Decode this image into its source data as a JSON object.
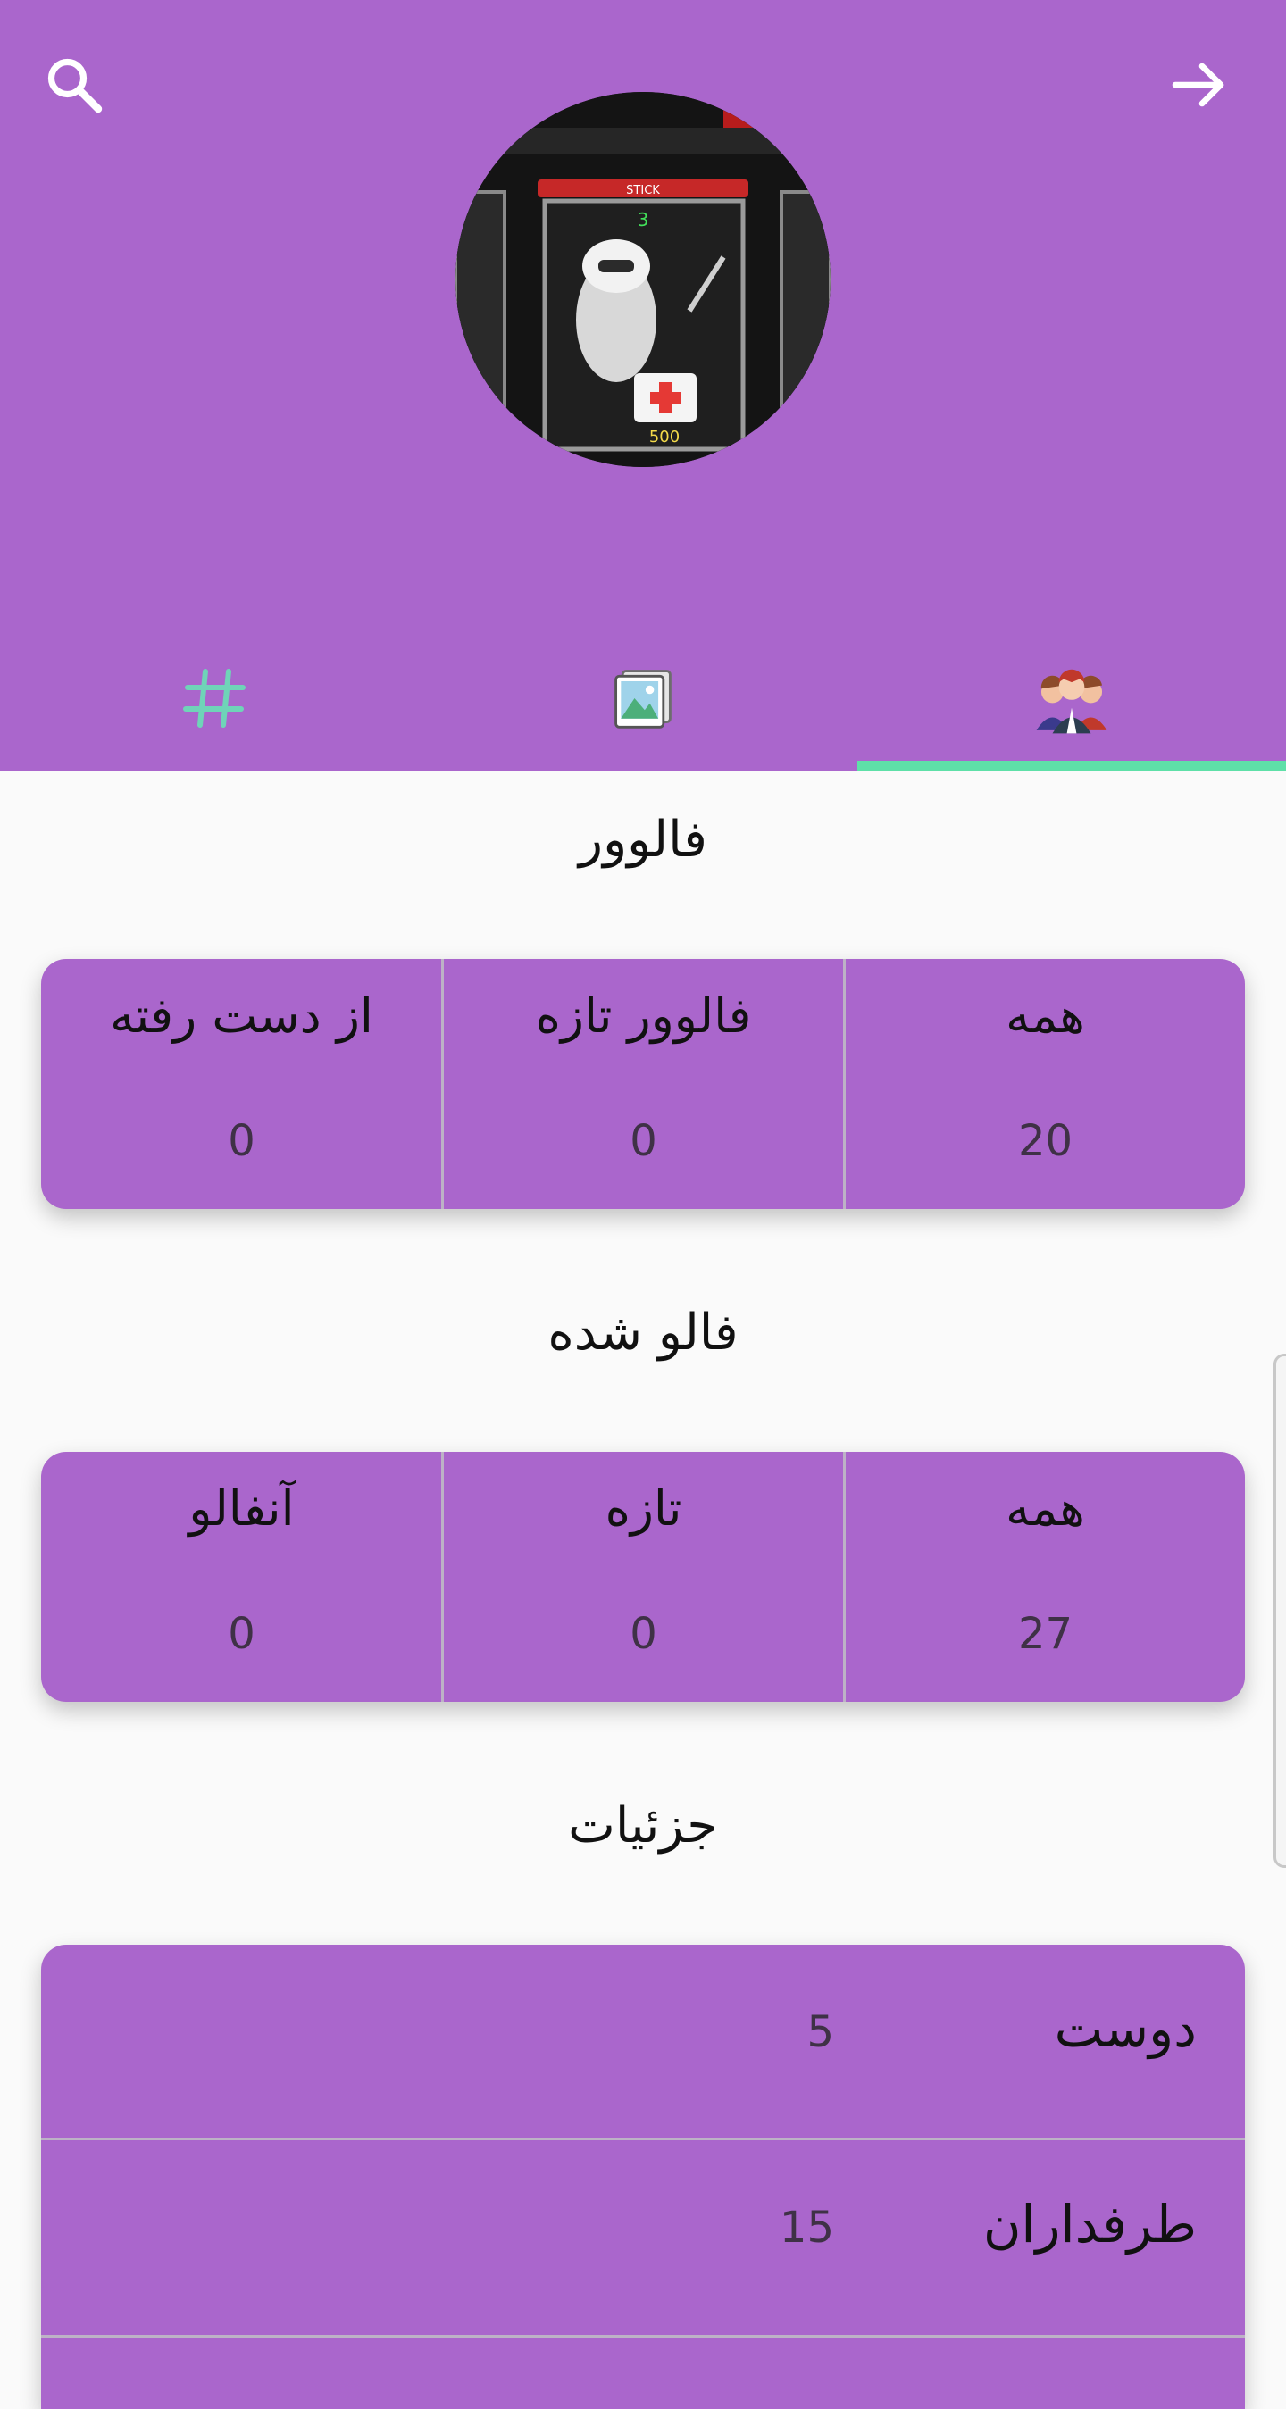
{
  "colors": {
    "purple": "#aa66cc",
    "accent_green": "#5ee0a8"
  },
  "header": {
    "search_icon": "search-icon",
    "back_icon": "arrow-right-icon",
    "avatar": {
      "badge_text": "3",
      "price_text": "500",
      "sign_text": "STICK"
    },
    "tabs": [
      {
        "icon": "hashtag-icon",
        "selected": false
      },
      {
        "icon": "image-gallery-icon",
        "selected": false
      },
      {
        "icon": "people-group-icon",
        "selected": true
      }
    ]
  },
  "followers": {
    "title": "فالوور",
    "stats": [
      {
        "label": "همه",
        "value": "20"
      },
      {
        "label": "فالوور تازه",
        "value": "0"
      },
      {
        "label": "از دست رفته",
        "value": "0"
      }
    ]
  },
  "following": {
    "title": "فالو شده",
    "stats": [
      {
        "label": "همه",
        "value": "27"
      },
      {
        "label": "تازه",
        "value": "0"
      },
      {
        "label": "آنفالو",
        "value": "0"
      }
    ]
  },
  "details": {
    "title": "جزئیات",
    "rows": [
      {
        "label": "دوست",
        "value": "5"
      },
      {
        "label": "طرفداران",
        "value": "15"
      }
    ]
  }
}
